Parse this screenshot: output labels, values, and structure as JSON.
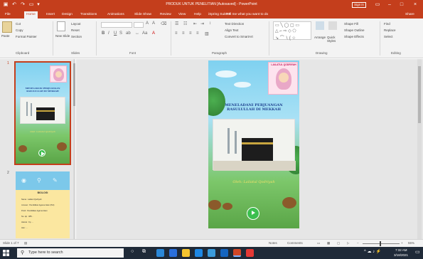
{
  "window": {
    "title": "PRODUK UNTUK PENELITIAN [Autosaved] - PowerPoint",
    "signin": "Sign in"
  },
  "tabs": [
    "File",
    "Home",
    "Insert",
    "Design",
    "Transitions",
    "Animations",
    "Slide Show",
    "Review",
    "View",
    "Help",
    "iSpring Suite 9"
  ],
  "tellme": "Tell me what you want to do",
  "share": "Share",
  "ribbon": {
    "clipboard": {
      "label": "Clipboard",
      "paste": "Paste",
      "cut": "Cut",
      "copy": "Copy",
      "format_painter": "Format Painter"
    },
    "slides": {
      "label": "Slides",
      "new_slide": "New Slide",
      "layout": "Layout",
      "reset": "Reset",
      "section": "Section"
    },
    "font": {
      "label": "Font"
    },
    "paragraph": {
      "label": "Paragraph",
      "text_direction": "Text Direction",
      "align_text": "Align Text",
      "convert_smartart": "Convert to SmartArt"
    },
    "drawing": {
      "label": "Drawing",
      "arrange": "Arrange",
      "quick_styles": "Quick Styles",
      "shape_fill": "Shape Fill",
      "shape_outline": "Shape Outline",
      "shape_effects": "Shape Effects"
    },
    "editing": {
      "label": "Editing",
      "find": "Find",
      "replace": "Replace",
      "select": "Select"
    }
  },
  "slides_panel": {
    "slide1_number": "1",
    "slide2_number": "2",
    "thumb1_title": "MENELADANI PERJUANGAN RASULULLAH DI MEKKAH",
    "thumb1_byline": "Oleh: Lailatul Qodriyah",
    "thumb2_title": "BIOLOGI",
    "thumb2_lines": [
      "Nama : Lailatul Qodriyah",
      "Jurusan : Pendidikan Agama Islam (PAI)",
      "Prodi : Pendidikan Agama Islam",
      "No. Hp : 085...",
      "Alamat : Kp. ...",
      "Alat : ..."
    ]
  },
  "main_slide": {
    "badge": "LAILATUL QODRIYAH",
    "title": "MENELADANI PERJUANGAN RASULULLAH DI MEKKAH",
    "byline": "Oleh: Lailatul Qodriyah"
  },
  "status": {
    "slide_count": "Slide 1 of 7",
    "notes": "Notes",
    "comments": "Comments",
    "zoom": "55%"
  },
  "taskbar": {
    "search_placeholder": "Type here to search",
    "time": "7:32 AM",
    "date": "3/18/2021"
  }
}
